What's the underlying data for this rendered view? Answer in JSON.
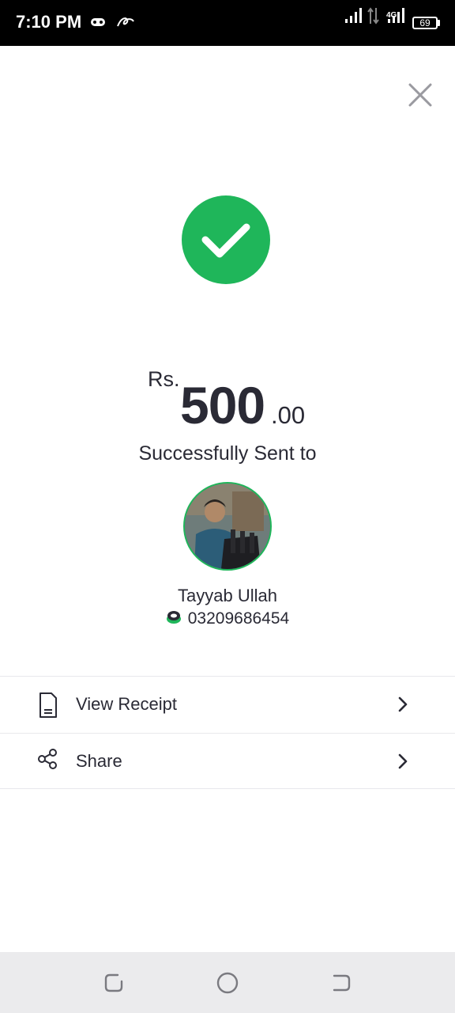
{
  "status_bar": {
    "time": "7:10 PM",
    "network": "4G",
    "battery": "69",
    "icons": [
      "game-controller-icon",
      "app-notification-icon",
      "signal-icon",
      "data-transfer-icon",
      "battery-icon"
    ]
  },
  "close_icon": "close-icon",
  "success_icon": "checkmark-icon",
  "transaction": {
    "currency": "Rs.",
    "amount_whole": "500",
    "amount_decimal": ".00",
    "status_text": "Successfully Sent to"
  },
  "recipient": {
    "name": "Tayyab Ullah",
    "phone": "03209686454",
    "wallet_icon": "wallet-brand-icon"
  },
  "actions": [
    {
      "label": "View Receipt",
      "icon": "receipt-icon"
    },
    {
      "label": "Share",
      "icon": "share-icon"
    }
  ],
  "nav": [
    "recent-apps-icon",
    "home-icon",
    "back-icon"
  ],
  "colors": {
    "accent": "#1fb65a",
    "text": "#2a2a35",
    "status_bar": "#000000",
    "nav_bar": "#ebebed"
  }
}
